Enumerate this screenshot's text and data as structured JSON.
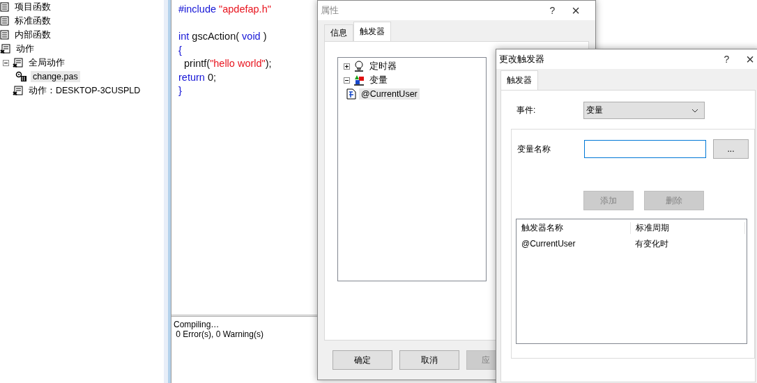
{
  "project_tree": [
    {
      "label": "项目函数",
      "kind": "function",
      "selected": false
    },
    {
      "label": "标准函数",
      "kind": "function",
      "selected": false
    },
    {
      "label": "内部函数",
      "kind": "function",
      "selected": false
    },
    {
      "label": "动作",
      "kind": "action",
      "selected": false,
      "children": [
        {
          "label": "全局动作",
          "kind": "action",
          "expanded": true,
          "selected": false,
          "children": [
            {
              "label": "change.pas",
              "kind": "script",
              "selected": true
            }
          ]
        },
        {
          "label": "动作：DESKTOP-3CUSPLD",
          "kind": "action",
          "selected": false
        }
      ]
    }
  ],
  "editor": {
    "code_lines": [
      {
        "kind": "code",
        "spans": [
          {
            "text": "#include ",
            "kind": "keyword"
          },
          {
            "text": "\"apdefap.h\"",
            "kind": "string"
          }
        ]
      },
      {
        "kind": "blank"
      },
      {
        "kind": "code",
        "spans": [
          {
            "text": "int",
            "kind": "keyword"
          },
          {
            "text": " gscAction( ",
            "kind": "plain"
          },
          {
            "text": "void",
            "kind": "keyword"
          },
          {
            "text": " )",
            "kind": "plain"
          }
        ]
      },
      {
        "kind": "code",
        "spans": [
          {
            "text": "{",
            "kind": "keyword"
          }
        ]
      },
      {
        "kind": "code",
        "spans": [
          {
            "text": "  printf(",
            "kind": "plain"
          },
          {
            "text": "\"hello world\"",
            "kind": "string"
          },
          {
            "text": ");",
            "kind": "plain"
          }
        ]
      },
      {
        "kind": "code",
        "spans": [
          {
            "text": "return",
            "kind": "keyword"
          },
          {
            "text": " 0;",
            "kind": "plain"
          }
        ]
      },
      {
        "kind": "code",
        "spans": [
          {
            "text": "}",
            "kind": "keyword"
          }
        ]
      }
    ]
  },
  "output": {
    "lines": [
      "Compiling…",
      " 0 Error(s), 0 Warning(s)"
    ]
  },
  "properties_dialog": {
    "title": "属性",
    "help": "?",
    "close": "×",
    "tabs": [
      {
        "label": "信息",
        "selected": false
      },
      {
        "label": "触发器",
        "selected": true
      }
    ],
    "trigger_tree": [
      {
        "label": "定时器",
        "kind": "timer",
        "expanded": false,
        "selected": false
      },
      {
        "label": "变量",
        "kind": "variable",
        "expanded": true,
        "selected": false,
        "children": [
          {
            "label": "@CurrentUser",
            "kind": "tag",
            "selected": true
          }
        ]
      }
    ],
    "buttons": [
      {
        "label": "确定",
        "disabled": false
      },
      {
        "label": "取消",
        "disabled": false
      },
      {
        "label": "应",
        "disabled": true
      }
    ]
  },
  "change_trigger_dialog": {
    "title": "更改触发器",
    "help": "?",
    "close": "×",
    "tabs": [
      {
        "label": "触发器",
        "selected": true
      }
    ],
    "event_label": "事件:",
    "event_value": "变量",
    "variable_label": "变量名称",
    "variable_field": {
      "focused": true
    },
    "browse_button": "...",
    "buttons": [
      {
        "label": "添加",
        "disabled": true
      },
      {
        "label": "删除",
        "disabled": true
      }
    ],
    "table": {
      "columns": [
        "触发器名称",
        "标准周期"
      ],
      "rows": [
        [
          "@CurrentUser",
          "有变化时"
        ]
      ]
    }
  }
}
